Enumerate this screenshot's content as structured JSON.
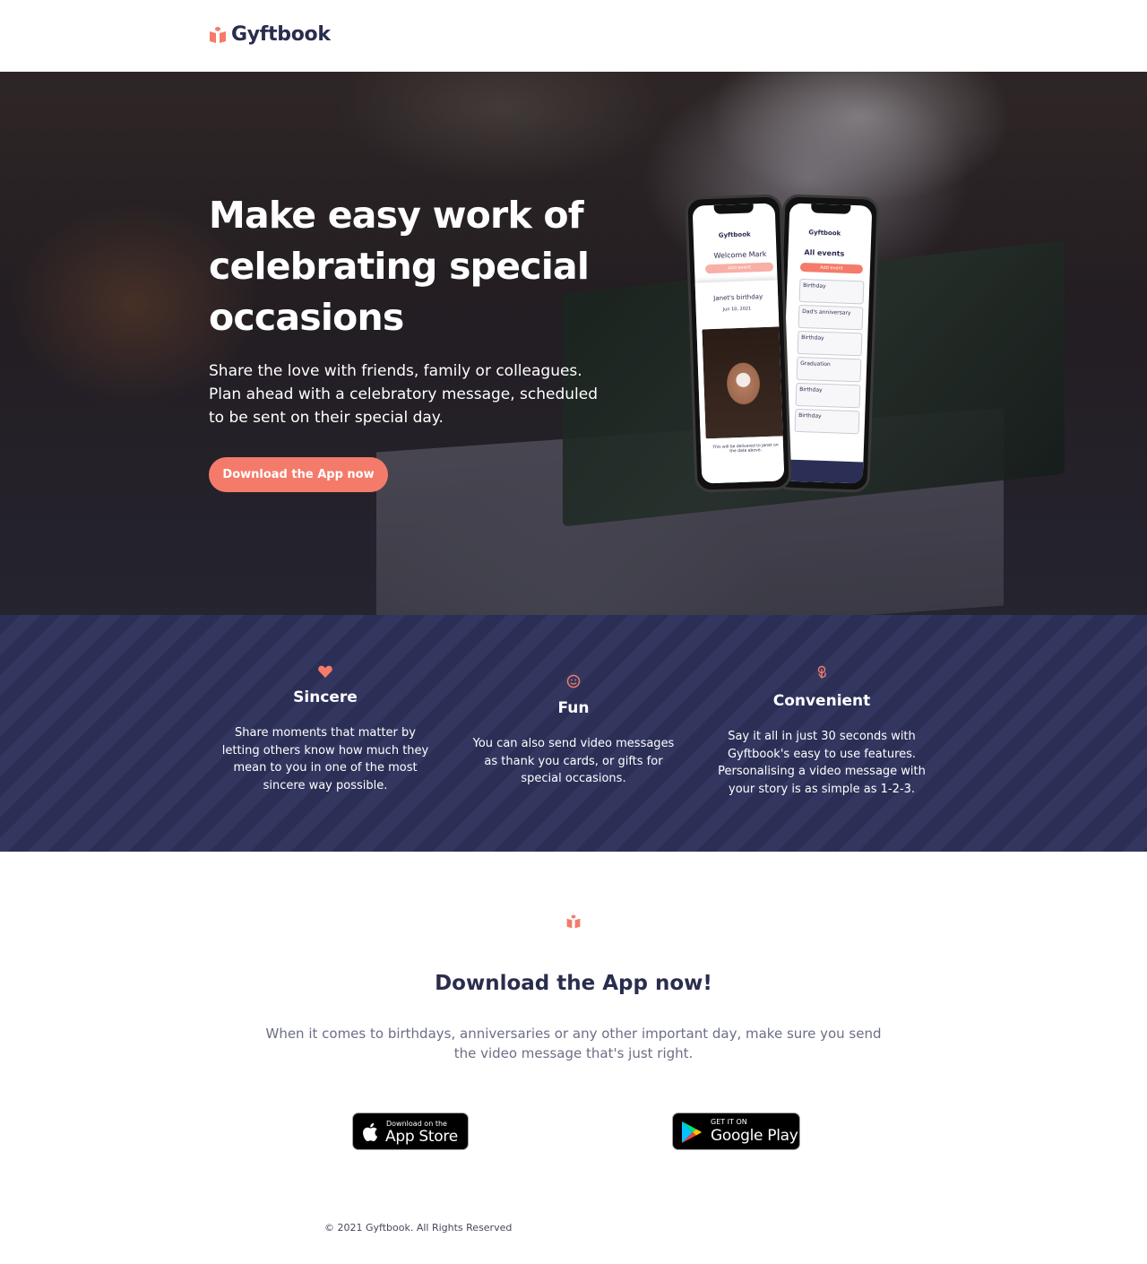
{
  "header": {
    "brand": "Gyftbook",
    "logo_icon": "gift-icon"
  },
  "hero": {
    "title": "Make easy work of celebrating special occasions",
    "subtitle": "Share the love with friends, family or colleagues. Plan ahead with a celebratory message, scheduled to be sent on their special day.",
    "cta_label": "Download the App now",
    "phone_front": {
      "brand": "Gyftbook",
      "welcome": "Welcome Mark",
      "add_event": "Add event",
      "event_title": "Janet's birthday",
      "event_date": "Jun 10, 2021",
      "delivery_note": "This will be delivered to Janet on the date above."
    },
    "phone_back": {
      "brand": "Gyftbook",
      "heading": "All events",
      "add_event": "Add event",
      "rows": [
        "Birthday",
        "Dad's anniversary",
        "Birthday",
        "Graduation",
        "Birthday",
        "Birthday"
      ]
    }
  },
  "features": [
    {
      "icon": "heart-icon",
      "title": "Sincere",
      "text": "Share moments that matter by letting others know how much they mean to you in one of the most sincere way possible."
    },
    {
      "icon": "smiley-icon",
      "title": "Fun",
      "text": "You can also send video messages as thank you cards, or gifts for special occasions."
    },
    {
      "icon": "touch-icon",
      "title": "Convenient",
      "text": "Say it all in just 30 seconds with Gyftbook's easy to use features. Personalising a video message with your story is as simple as 1-2-3."
    }
  ],
  "download": {
    "icon": "gift-icon",
    "title": "Download the App now!",
    "text": "When it comes to birthdays, anniversaries or any other important day, make sure you send the video message that's just right.",
    "app_store": {
      "small": "Download on the",
      "big": "App Store"
    },
    "google_play": {
      "small": "GET IT ON",
      "big": "Google Play"
    }
  },
  "footer": {
    "copyright": "© 2021 Gyftbook. All Rights Reserved"
  },
  "colors": {
    "accent": "#f47b6a",
    "navy": "#2b2f55",
    "brand_text": "#2a2d4e"
  }
}
